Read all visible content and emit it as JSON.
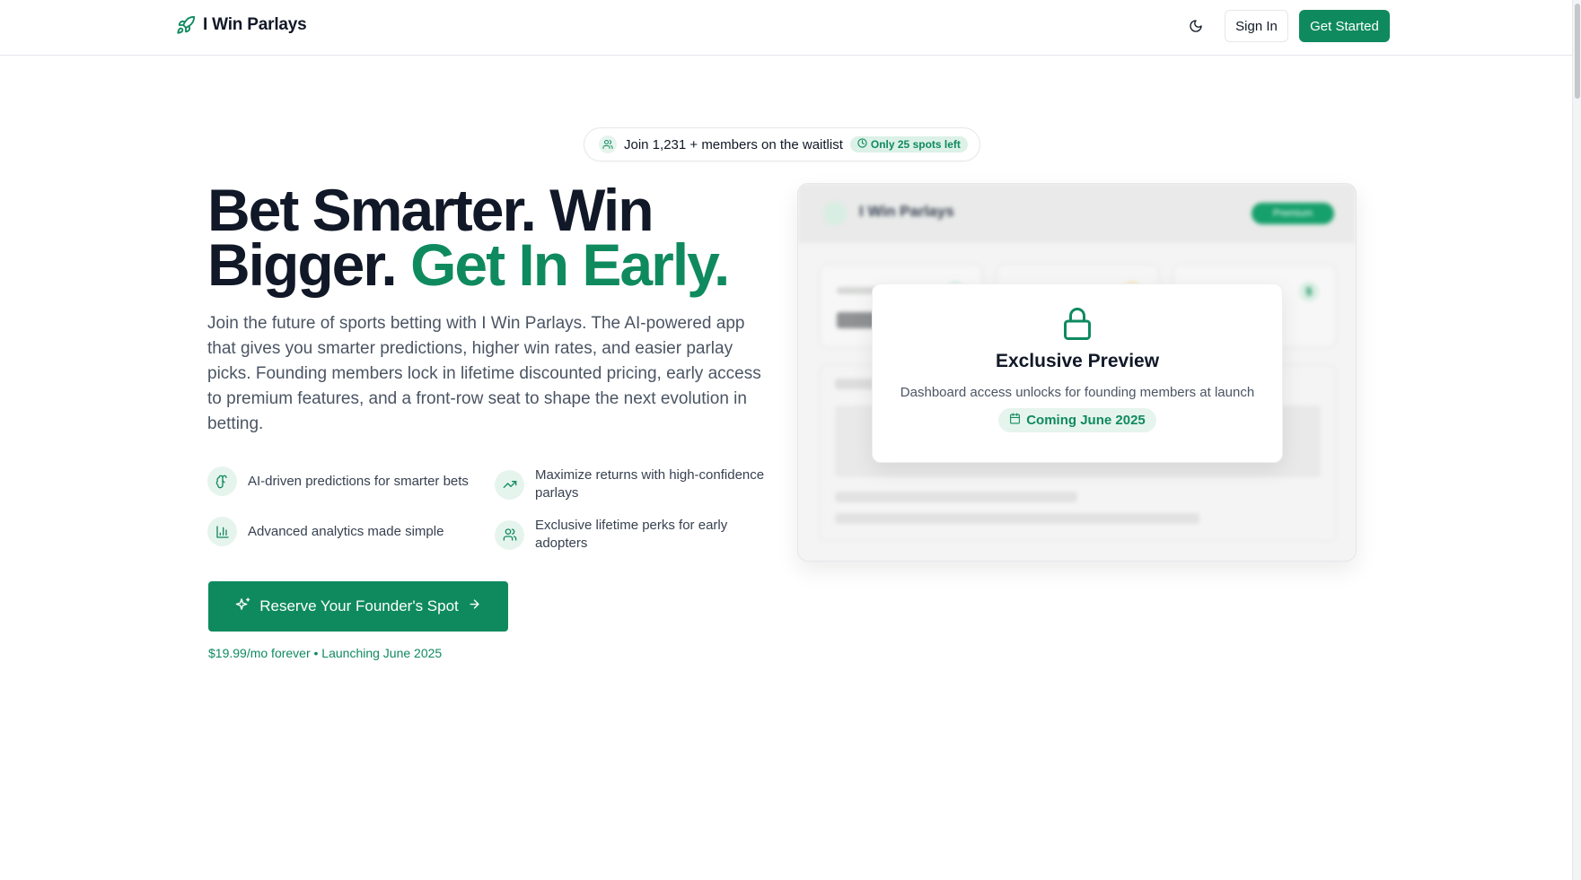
{
  "header": {
    "brand_name": "I Win Parlays",
    "brand_icon": "rocket-icon",
    "theme_icon": "moon-icon",
    "signin_label": "Sign In",
    "get_started_label": "Get Started"
  },
  "waitlist": {
    "text": "Join 1,231 + members on the waitlist",
    "badge": "Only 25 spots left"
  },
  "hero": {
    "title_line1": "Bet Smarter. Win",
    "title_line2_a": "Bigger.",
    "title_line2_b": "Get In Early.",
    "description": "Join the future of sports betting with I Win Parlays. The AI-powered app that gives you smarter predictions, higher win rates, and easier parlay picks. Founding members lock in lifetime discounted pricing, early access to premium features, and a front-row seat to shape the next evolution in betting."
  },
  "features": [
    {
      "icon": "brain-icon",
      "text": "AI-driven predictions for smarter bets"
    },
    {
      "icon": "trending-up-icon",
      "text": "Maximize returns with high-confidence parlays"
    },
    {
      "icon": "bar-chart-icon",
      "text": "Advanced analytics made simple"
    },
    {
      "icon": "users-icon",
      "text": "Exclusive lifetime perks for early adopters"
    }
  ],
  "cta": {
    "label": "Reserve Your Founder's Spot",
    "subtext": "$19.99/mo forever • Launching June 2025"
  },
  "preview": {
    "app_name": "I Win Parlays",
    "badge": "Premium",
    "stat_dollar": "$",
    "overlay_title": "Exclusive Preview",
    "overlay_subtitle": "Dashboard access unlocks for founding members at launch",
    "coming_label": "Coming June 2025"
  },
  "colors": {
    "accent": "#0f8a5f",
    "accent_light": "#e6f4ee",
    "text": "#111827",
    "muted": "#4b5563"
  }
}
